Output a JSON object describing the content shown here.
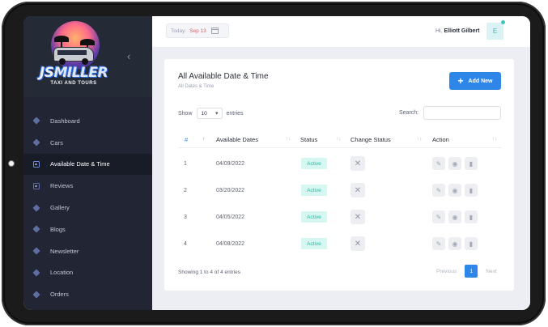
{
  "brand": {
    "name_part1": "JS",
    "name_part2": "MILLER",
    "tagline": "TAXI AND TOURS"
  },
  "sidebar": {
    "items": [
      {
        "label": "Dashboard",
        "icon": "cube-icon"
      },
      {
        "label": "Cars",
        "icon": "cube-icon"
      },
      {
        "label": "Available Date & Time",
        "icon": "calendar-icon",
        "active": true
      },
      {
        "label": "Reviews",
        "icon": "calendar-icon"
      },
      {
        "label": "Gallery",
        "icon": "cube-icon"
      },
      {
        "label": "Blogs",
        "icon": "cube-icon"
      },
      {
        "label": "Newsletter",
        "icon": "cube-icon"
      },
      {
        "label": "Location",
        "icon": "cube-icon"
      },
      {
        "label": "Orders",
        "icon": "cube-icon"
      }
    ]
  },
  "topbar": {
    "today_label": "Today:",
    "today_date": "Sep 13",
    "greeting_prefix": "Hi,",
    "user_name": "Elliott Gilbert",
    "avatar_initial": "E"
  },
  "page": {
    "title": "All Available Date & Time",
    "breadcrumb": "All Dates & Time",
    "add_button_label": "Add New"
  },
  "table_controls": {
    "show_label": "Show",
    "entries_value": "10",
    "entries_label": "entries",
    "search_label": "Search:"
  },
  "table": {
    "headers": {
      "num": "#",
      "date": "Available Dates",
      "status": "Status",
      "change_status": "Change Status",
      "action": "Action"
    },
    "rows": [
      {
        "num": "1",
        "date": "04/09/2022",
        "status": "Active"
      },
      {
        "num": "2",
        "date": "03/20/2022",
        "status": "Active"
      },
      {
        "num": "3",
        "date": "04/05/2022",
        "status": "Active"
      },
      {
        "num": "4",
        "date": "04/08/2022",
        "status": "Active"
      }
    ]
  },
  "footer": {
    "info": "Showing 1 to 4 of 4 entries",
    "prev": "Previous",
    "current_page": "1",
    "next": "Next"
  },
  "colors": {
    "sidebar_bg": "#222634",
    "accent": "#2f86e9",
    "active_badge": "#2cb79f"
  }
}
